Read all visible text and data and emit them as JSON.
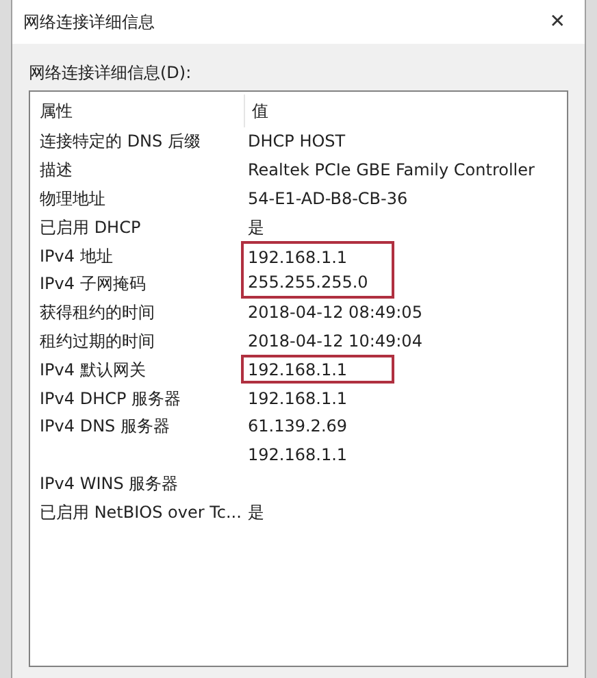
{
  "window": {
    "title": "网络连接详细信息",
    "close": "✕"
  },
  "label": "网络连接详细信息(D):",
  "table": {
    "columns": [
      "属性",
      "值"
    ],
    "rows": [
      {
        "property": "连接特定的 DNS 后缀",
        "value": "DHCP HOST",
        "highlighted": false
      },
      {
        "property": "描述",
        "value": "Realtek PCIe GBE Family Controller",
        "highlighted": false
      },
      {
        "property": "物理地址",
        "value": "54-E1-AD-B8-CB-36",
        "highlighted": false
      },
      {
        "property": "已启用 DHCP",
        "value": "是",
        "highlighted": false
      },
      {
        "property": "IPv4 地址",
        "value": "192.168.1.1",
        "highlighted": true
      },
      {
        "property": "IPv4 子网掩码",
        "value": "255.255.255.0",
        "highlighted": true
      },
      {
        "property": "获得租约的时间",
        "value": "2018-04-12 08:49:05",
        "highlighted": false
      },
      {
        "property": "租约过期的时间",
        "value": "2018-04-12 10:49:04",
        "highlighted": false
      },
      {
        "property": "IPv4 默认网关",
        "value": "192.168.1.1",
        "highlighted": true
      },
      {
        "property": "IPv4 DHCP 服务器",
        "value": "192.168.1.1",
        "highlighted": false
      },
      {
        "property": "IPv4 DNS 服务器",
        "value": "61.139.2.69",
        "highlighted": false
      },
      {
        "property": "",
        "value": "192.168.1.1",
        "highlighted": false
      },
      {
        "property": "IPv4 WINS 服务器",
        "value": "",
        "highlighted": false
      },
      {
        "property": "已启用 NetBIOS over Tc...",
        "value": "是",
        "highlighted": false
      }
    ]
  }
}
